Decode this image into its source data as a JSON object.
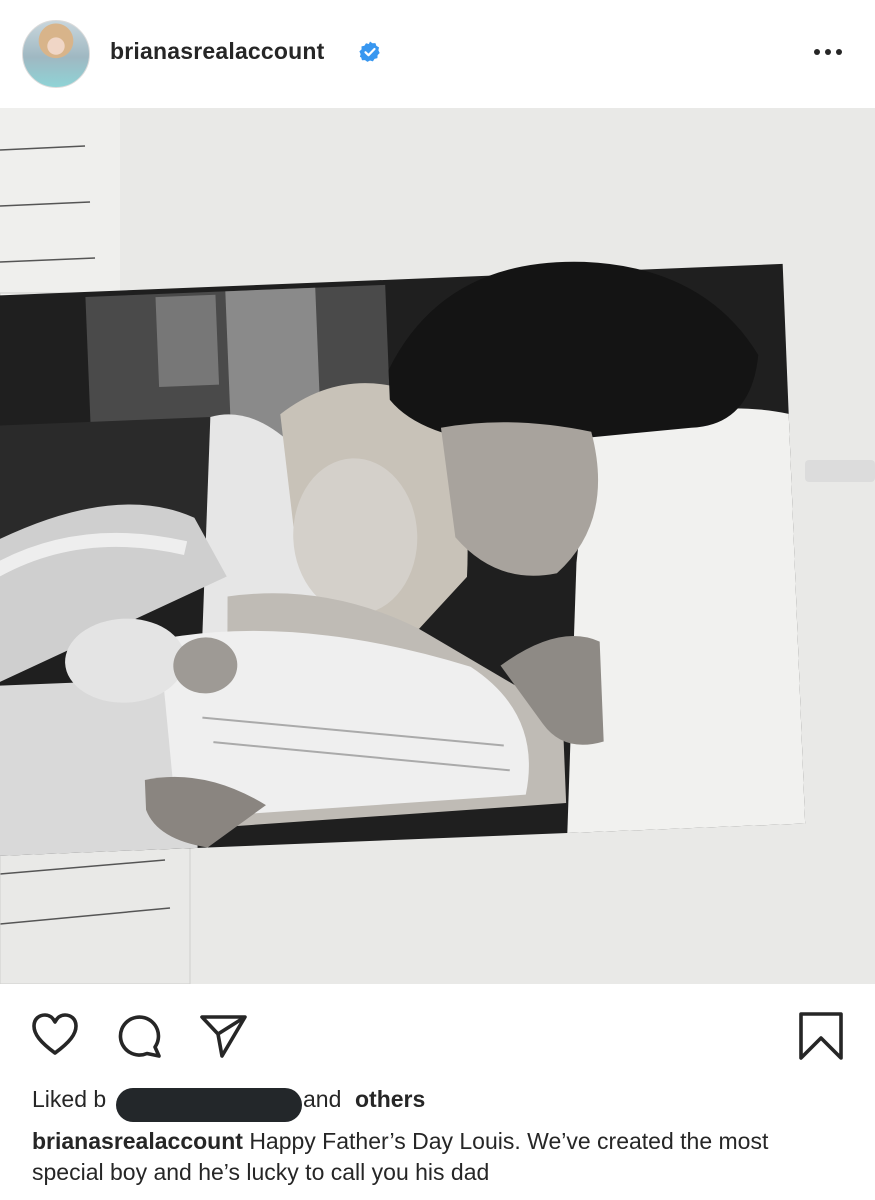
{
  "post": {
    "username": "brianasrealaccount",
    "verified": true,
    "accent_color": "#3897f0",
    "more_icon": "more-horizontal-icon"
  },
  "actions": {
    "icons": [
      "heart-icon",
      "comment-icon",
      "share-icon",
      "bookmark-icon"
    ]
  },
  "likes": {
    "prefix": "Liked b",
    "middle": "and",
    "others": "others"
  },
  "caption": {
    "username": "brianasrealaccount",
    "text": "Happy Father’s Day Louis. We’ve created the most special boy and he’s lucky to call you his dad"
  }
}
